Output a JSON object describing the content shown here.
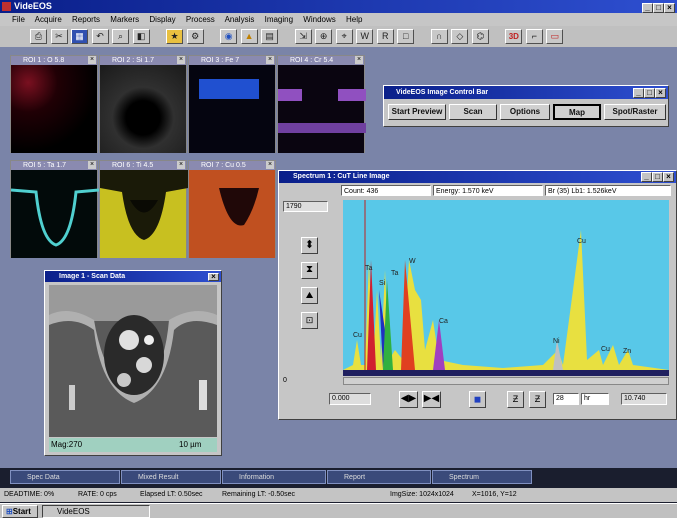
{
  "app": {
    "title": "VideEOS",
    "menu": [
      "File",
      "Acquire",
      "Reports",
      "Markers",
      "Display",
      "Process",
      "Analysis",
      "Imaging",
      "Windows",
      "Help"
    ]
  },
  "toolbar": {
    "buttons": [
      "⎙",
      "✂",
      "▦",
      "↶",
      "⌕",
      "◧",
      "⌁",
      "★",
      "⚙",
      "◉",
      "▲",
      "▤",
      "⇲",
      "⊕",
      "⌖",
      "W",
      "R",
      "□",
      "∩",
      "◇",
      "⌬",
      "3D",
      "⌐",
      "▭"
    ]
  },
  "thumbnails": [
    {
      "label": "ROI 1 : O 5.8"
    },
    {
      "label": "ROI 2 : Si 1.7"
    },
    {
      "label": "ROI 3 : Fe 7"
    },
    {
      "label": "ROI 4 : Cr 5.4"
    },
    {
      "label": "ROI 5 : Ta 1.7"
    },
    {
      "label": "ROI 6 : Ti 4.5"
    },
    {
      "label": "ROI 7 : Cu 0.5"
    }
  ],
  "control_bar": {
    "title": "VideEOS Image Control Bar",
    "buttons": [
      "Start Preview",
      "Scan",
      "Options",
      "Map",
      "Spot/Raster"
    ]
  },
  "image_window": {
    "title": "Image 1 - Scan Data",
    "mag": "Mag:270",
    "scale": "10 µm"
  },
  "spectrum": {
    "title": "Spectrum 1 : CuT Line Image",
    "count": "Count: 436",
    "energy": "Energy: 1.570 keV",
    "line": "Br (35) Lb1: 1.526keV",
    "ymax": "1790",
    "ymin": "0",
    "xmin": "0.000",
    "xmax": "10.740",
    "range_val": "28",
    "range_unit": "hr",
    "peaks": [
      "Cu",
      "Si",
      "Ta",
      "Ta",
      "W",
      "Ca",
      "Cu",
      "Ni",
      "Cu",
      "Zn"
    ]
  },
  "minimized": [
    {
      "label": "Spec Data"
    },
    {
      "label": "Mixed Result"
    },
    {
      "label": "Information"
    },
    {
      "label": "Report"
    },
    {
      "label": "Spectrum"
    }
  ],
  "status": {
    "deadtime": "DEADTIME: 0%",
    "rate": "RATE: 0  cps",
    "elapsed": "Elapsed LT: 0.50sec",
    "remaining": "Remaining LT: -0.50sec",
    "imgsize": "ImgSize: 1024x1024",
    "coords": "X=1016, Y=12"
  },
  "taskbar": {
    "start": "Start",
    "app": "VideEOS"
  }
}
